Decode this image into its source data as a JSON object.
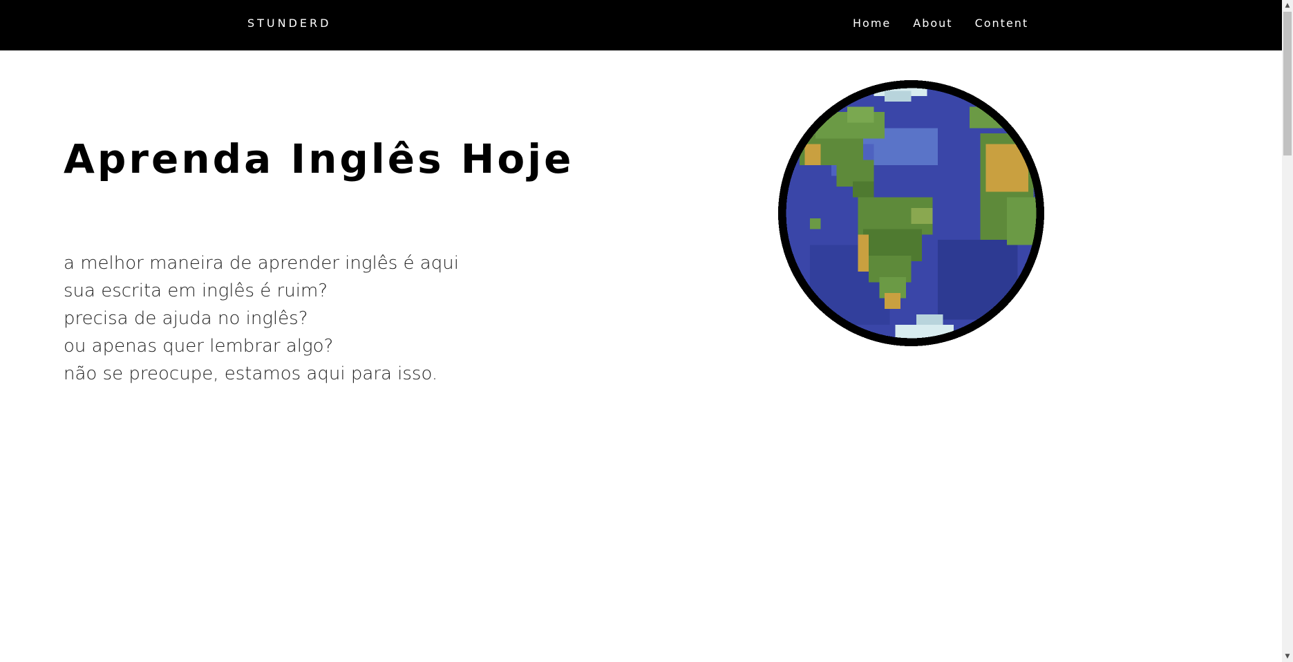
{
  "header": {
    "brand": "STUNDERD",
    "nav": [
      "Home",
      "About",
      "Content"
    ]
  },
  "hero": {
    "title": "Aprenda Inglês Hoje",
    "lines": [
      "a melhor maneira de aprender inglês é aqui",
      "sua escrita em inglês é ruim?",
      "precisa de ajuda no inglês?",
      "ou apenas quer lembrar algo?",
      "não se preocupe, estamos aqui para isso."
    ]
  },
  "icons": {
    "globe": "earth-globe-pixel-art",
    "scroll_up": "chevron-up-icon",
    "scroll_down": "chevron-down-icon"
  },
  "colors": {
    "header_bg": "#000000",
    "header_text": "#ffffff",
    "ocean": "#3a46a8",
    "land": "#5e8a3a",
    "desert": "#c9a040",
    "ice": "#d8ecef"
  }
}
